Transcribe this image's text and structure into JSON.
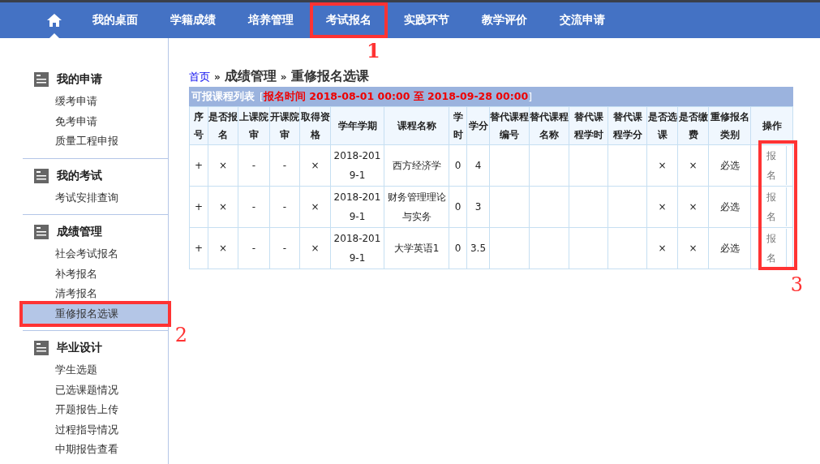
{
  "nav": {
    "items": [
      {
        "kind": "home",
        "selected": true,
        "highlighted": false
      },
      {
        "kind": "text",
        "label": "我的桌面",
        "selected": false,
        "highlighted": false
      },
      {
        "kind": "text",
        "label": "学籍成绩",
        "selected": false,
        "highlighted": false
      },
      {
        "kind": "text",
        "label": "培养管理",
        "selected": false,
        "highlighted": false
      },
      {
        "kind": "text",
        "label": "考试报名",
        "selected": false,
        "highlighted": true,
        "annotation": "1"
      },
      {
        "kind": "text",
        "label": "实践环节",
        "selected": false,
        "highlighted": false
      },
      {
        "kind": "text",
        "label": "教学评价",
        "selected": false,
        "highlighted": false
      },
      {
        "kind": "text",
        "label": "交流申请",
        "selected": false,
        "highlighted": false
      }
    ]
  },
  "sidebar": {
    "sections": [
      {
        "title": "我的申请",
        "items": [
          {
            "label": "缓考申请",
            "selected": false,
            "highlighted": false
          },
          {
            "label": "免考申请",
            "selected": false,
            "highlighted": false
          },
          {
            "label": "质量工程申报",
            "selected": false,
            "highlighted": false
          }
        ]
      },
      {
        "title": "我的考试",
        "items": [
          {
            "label": "考试安排查询",
            "selected": false,
            "highlighted": false
          }
        ]
      },
      {
        "title": "成绩管理",
        "items": [
          {
            "label": "社会考试报名",
            "selected": false,
            "highlighted": false
          },
          {
            "label": "补考报名",
            "selected": false,
            "highlighted": false
          },
          {
            "label": "清考报名",
            "selected": false,
            "highlighted": false
          },
          {
            "label": "重修报名选课",
            "selected": true,
            "highlighted": true,
            "annotation": "2"
          }
        ]
      },
      {
        "title": "毕业设计",
        "items": [
          {
            "label": "学生选题",
            "selected": false,
            "highlighted": false
          },
          {
            "label": "已选课题情况",
            "selected": false,
            "highlighted": false
          },
          {
            "label": "开题报告上传",
            "selected": false,
            "highlighted": false
          },
          {
            "label": "过程指导情况",
            "selected": false,
            "highlighted": false
          },
          {
            "label": "中期报告查看",
            "selected": false,
            "highlighted": false
          }
        ]
      }
    ]
  },
  "breadcrumb": {
    "home": "首页",
    "separator": "»",
    "trail": [
      "成绩管理",
      "重修报名选课"
    ]
  },
  "table": {
    "title": "可报课程列表",
    "bracket_open": "[",
    "note": "报名时间 2018-08-01 00:00 至 2018-09-28 00:00",
    "bracket_close": "]",
    "columns": [
      "序号",
      "是否报名",
      "上课院审",
      "开课院审",
      "取得资格",
      "学年学期",
      "课程名称",
      "学时",
      "学分",
      "替代课程编号",
      "替代课程名称",
      "替代课程学时",
      "替代课程学分",
      "是否选课",
      "是否缴费",
      "重修报名类别",
      "操作"
    ],
    "action_annotation": "3",
    "rows": [
      {
        "cells": [
          "+",
          "×",
          "-",
          "-",
          "×",
          "2018-2019-1",
          "西方经济学",
          "0",
          "4",
          "",
          "",
          "",
          "",
          "×",
          "×",
          "必选"
        ],
        "action": "报名"
      },
      {
        "cells": [
          "+",
          "×",
          "-",
          "-",
          "×",
          "2018-2019-1",
          "财务管理理论与实务",
          "0",
          "3",
          "",
          "",
          "",
          "",
          "×",
          "×",
          "必选"
        ],
        "action": "报名"
      },
      {
        "cells": [
          "+",
          "×",
          "-",
          "-",
          "×",
          "2018-2019-1",
          "大学英语1",
          "0",
          "3.5",
          "",
          "",
          "",
          "",
          "×",
          "×",
          "必选"
        ],
        "action": "报名"
      }
    ]
  }
}
